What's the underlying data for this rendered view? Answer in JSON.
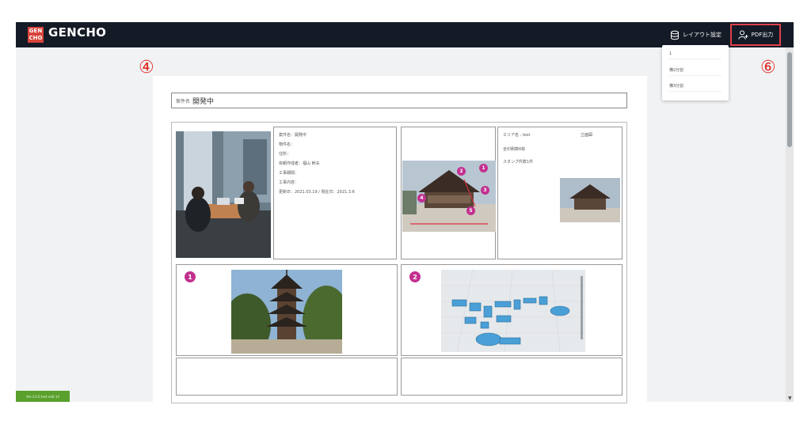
{
  "header": {
    "logo_line1": "GEN",
    "logo_line2": "CHO",
    "app_title": "GENCHO",
    "layout_button_label": "レイアウト設定",
    "pdf_button_label": "PDF出力"
  },
  "annotations": {
    "marker_left": "④",
    "marker_right": "⑥"
  },
  "layout_menu": {
    "items": [
      "1",
      "横2分割",
      "横3分割"
    ]
  },
  "document": {
    "title_label": "案件名",
    "title_value": "開発中",
    "info_lines": [
      "案件名：開発中",
      "物件名：",
      "住所：",
      "依頼作成者：福山 幹夫",
      "工事期間：",
      "工事内容：",
      "更新日：2021.03.19 / 現在日：2021.3.6"
    ],
    "area_panel": {
      "area_label": "エリア名 : test",
      "area_value": "立面図",
      "photo_count": "全印刷数6枚",
      "stamp_count": "スタンプ件数1件"
    },
    "marker_badges": [
      "1",
      "2",
      "3",
      "4",
      "5"
    ],
    "cell_badges": [
      "1",
      "2"
    ]
  },
  "footer": {
    "status_label": "Ver.3.0.0 test edit 14"
  },
  "colors": {
    "header_bg": "#141a26",
    "accent_red": "#e0404a",
    "badge_magenta": "#c2308f",
    "status_green": "#5aa02c"
  }
}
